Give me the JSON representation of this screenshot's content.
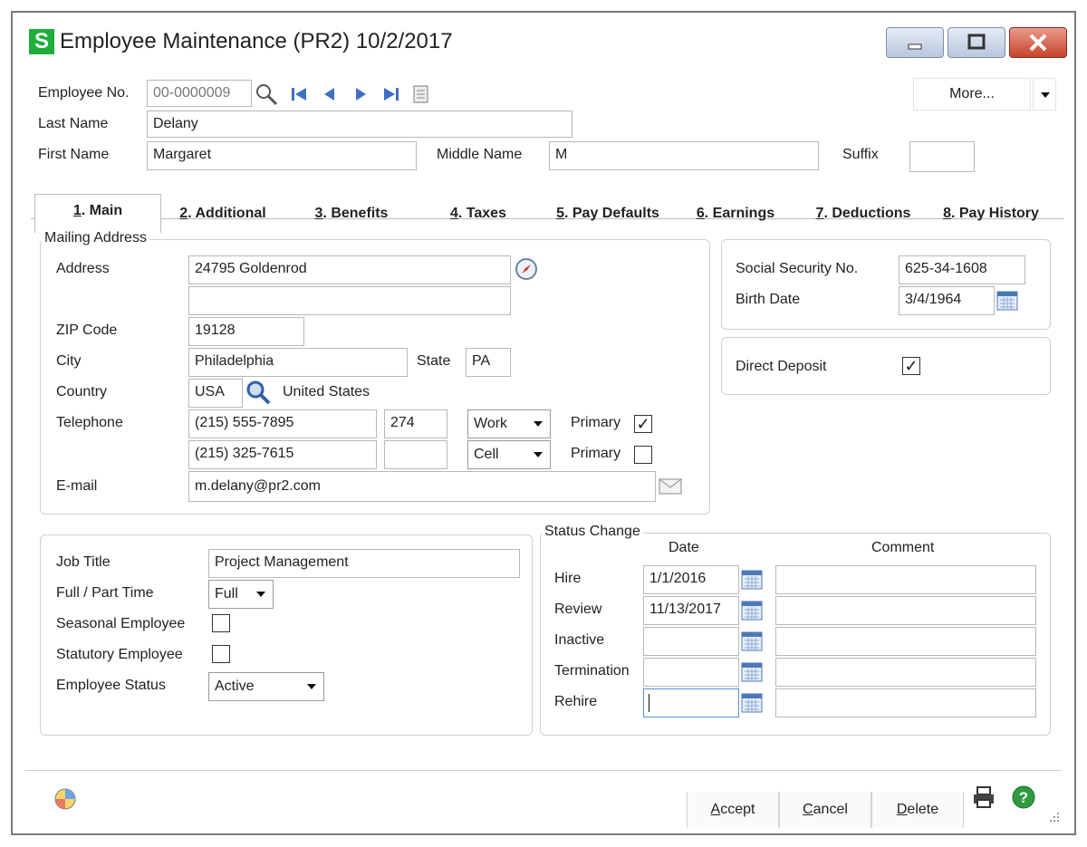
{
  "window": {
    "app_logo": "S",
    "title": "Employee Maintenance (PR2) 10/2/2017"
  },
  "header": {
    "employee_no_label": "Employee No.",
    "employee_no_value": "00-0000009",
    "last_name_label": "Last Name",
    "last_name_value": "Delany",
    "first_name_label": "First Name",
    "first_name_value": "Margaret",
    "middle_name_label": "Middle Name",
    "middle_name_value": "M",
    "suffix_label": "Suffix",
    "suffix_value": "",
    "more_label": "More..."
  },
  "tabs": [
    {
      "num": "1",
      "label": ". Main"
    },
    {
      "num": "2",
      "label": ". Additional"
    },
    {
      "num": "3",
      "label": ". Benefits"
    },
    {
      "num": "4",
      "label": ". Taxes"
    },
    {
      "num": "5",
      "label": ". Pay Defaults"
    },
    {
      "num": "6",
      "label": ". Earnings"
    },
    {
      "num": "7",
      "label": ". Deductions"
    },
    {
      "num": "8",
      "label": ". Pay History"
    }
  ],
  "mailing": {
    "group_title": "Mailing Address",
    "address_label": "Address",
    "address_line1": "24795 Goldenrod",
    "address_line2": "",
    "zip_label": "ZIP Code",
    "zip_value": "19128",
    "city_label": "City",
    "city_value": "Philadelphia",
    "state_label": "State",
    "state_value": "PA",
    "country_label": "Country",
    "country_value": "USA",
    "country_name": "United States",
    "telephone_label": "Telephone",
    "phones": [
      {
        "number": "(215) 555-7895",
        "ext": "274",
        "type": "Work",
        "primary_label": "Primary",
        "primary": true
      },
      {
        "number": "(215) 325-7615",
        "ext": "",
        "type": "Cell",
        "primary_label": "Primary",
        "primary": false
      }
    ],
    "email_label": "E-mail",
    "email_value": "m.delany@pr2.com"
  },
  "personal": {
    "ssn_label": "Social Security No.",
    "ssn_value": "625-34-1608",
    "birth_label": "Birth Date",
    "birth_value": "3/4/1964",
    "direct_deposit_label": "Direct Deposit",
    "direct_deposit": true
  },
  "job": {
    "job_title_label": "Job Title",
    "job_title_value": "Project Management",
    "full_part_label": "Full / Part Time",
    "full_part_value": "Full",
    "seasonal_label": "Seasonal Employee",
    "statutory_label": "Statutory Employee",
    "status_label": "Employee Status",
    "status_value": "Active"
  },
  "status_change": {
    "group_title": "Status Change",
    "date_header": "Date",
    "comment_header": "Comment",
    "rows": [
      {
        "label": "Hire",
        "date": "1/1/2016",
        "comment": ""
      },
      {
        "label": "Review",
        "date": "11/13/2017",
        "comment": ""
      },
      {
        "label": "Inactive",
        "date": "",
        "comment": ""
      },
      {
        "label": "Termination",
        "date": "",
        "comment": ""
      },
      {
        "label": "Rehire",
        "date": "",
        "comment": ""
      }
    ]
  },
  "footer": {
    "accept_ul": "A",
    "accept_rest": "ccept",
    "cancel_ul": "C",
    "cancel_rest": "ancel",
    "delete_ul": "D",
    "delete_rest": "elete"
  },
  "colors": {
    "logo_green": "#1fae3a",
    "nav_blue": "#3f6fc4",
    "help_green": "#2e9b3e"
  }
}
